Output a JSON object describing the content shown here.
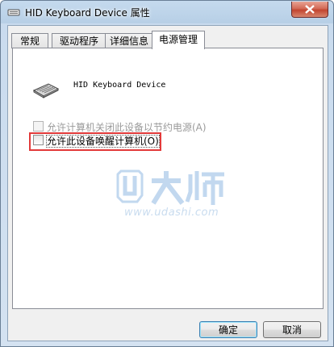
{
  "window": {
    "title": "HID Keyboard Device 属性"
  },
  "tabs": [
    {
      "label": "常规",
      "active": false
    },
    {
      "label": "驱动程序",
      "active": false
    },
    {
      "label": "详细信息",
      "active": false
    },
    {
      "label": "电源管理",
      "active": true
    }
  ],
  "device": {
    "name": "HID Keyboard Device",
    "icon": "keyboard-icon"
  },
  "options": [
    {
      "label": "允许计算机关闭此设备以节约电源(A)",
      "checked": false,
      "enabled": false
    },
    {
      "label": "允许此设备唤醒计算机(O)",
      "checked": false,
      "enabled": true
    }
  ],
  "watermark": {
    "logo_text": "U大师",
    "url": "www.udashi.com"
  },
  "buttons": {
    "ok": "确定",
    "cancel": "取消"
  },
  "colors": {
    "highlight": "#e23a3a",
    "close_button": "#c24530"
  }
}
